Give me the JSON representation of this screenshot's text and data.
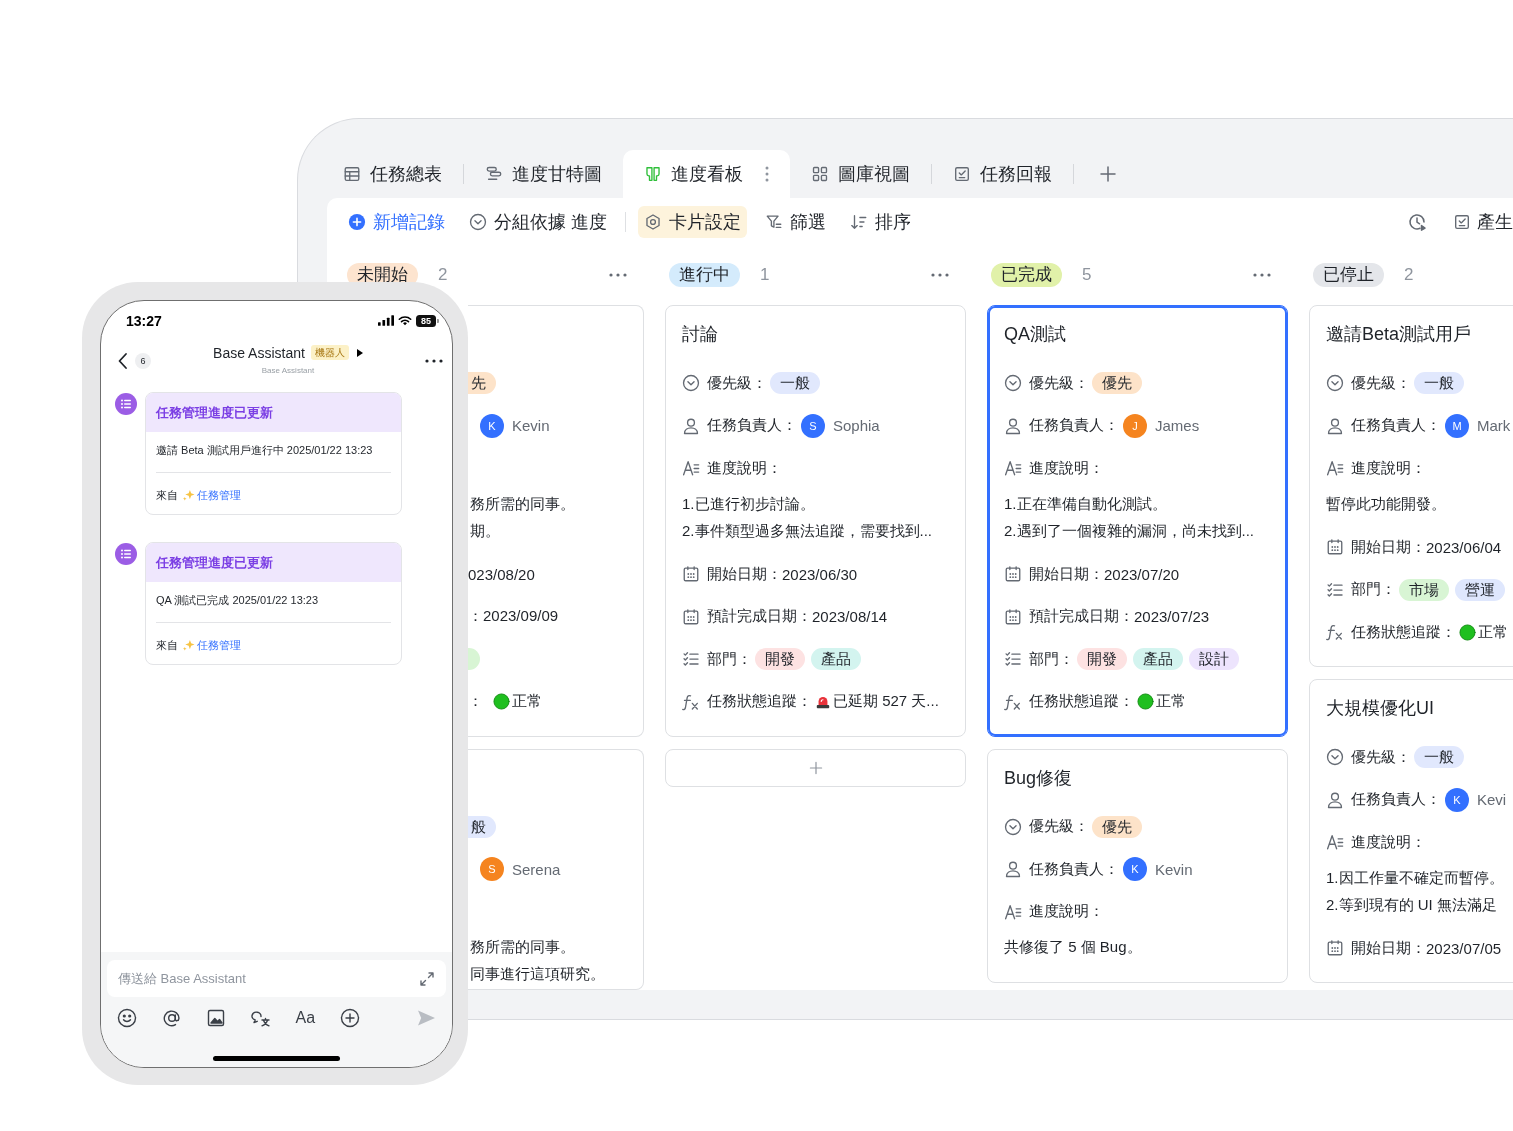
{
  "app": {
    "tabs": [
      {
        "kind": "table",
        "label": "任務總表",
        "selected": false
      },
      {
        "kind": "gantt",
        "label": "進度甘特圖",
        "selected": false
      },
      {
        "kind": "kanban",
        "label": "進度看板",
        "selected": true
      },
      {
        "kind": "gallery",
        "label": "圖庫視圖",
        "selected": false
      },
      {
        "kind": "form",
        "label": "任務回報",
        "selected": false
      }
    ],
    "toolbar": [
      {
        "kind": "add",
        "label": "新增記錄",
        "on": false
      },
      {
        "kind": "group",
        "label": "分組依據 進度",
        "on": false
      },
      {
        "kind": "card",
        "label": "卡片設定",
        "on": true
      },
      {
        "kind": "filter",
        "label": "篩選",
        "on": false
      },
      {
        "kind": "sort",
        "label": "排序",
        "on": false
      }
    ],
    "toolbar_right": [
      {
        "kind": "history"
      },
      {
        "kind": "report",
        "label": "產生"
      }
    ],
    "columns": [
      {
        "title": "未開始",
        "count": "2",
        "color": "#fde4cf",
        "more": true,
        "add_card": false,
        "cards": [
          {
            "selected": false,
            "overlapped": true,
            "fields": [
              {
                "kind": "priority",
                "value": "先",
                "color": "#fde3c9"
              },
              {
                "kind": "assignee",
                "initial": "K",
                "name": "Kevin",
                "color": "#3370ff"
              },
              {
                "kind": "description",
                "lines": [
                  "務所需的同事。",
                  "期。"
                ]
              },
              {
                "kind": "date",
                "value": "023/08/20"
              },
              {
                "kind": "date",
                "value": "：2023/09/09"
              },
              {
                "kind": "tags",
                "tags": [
                  {
                    "color": "#d8f5d4"
                  }
                ]
              },
              {
                "kind": "status",
                "label": "：",
                "overdue": false,
                "value": "正常"
              }
            ]
          },
          {
            "selected": false,
            "overlapped": true,
            "fields": [
              {
                "kind": "priority",
                "value": "般",
                "color": "#e1e8fd"
              },
              {
                "kind": "assignee",
                "initial": "S",
                "name": "Serena",
                "color": "#f5841f"
              },
              {
                "kind": "description",
                "lines": [
                  "務所需的同事。",
                  "同事進行這項研究。"
                ]
              }
            ]
          }
        ]
      },
      {
        "title": "進行中",
        "count": "1",
        "color": "#d4ebfc",
        "more": true,
        "add_card": true,
        "cards": [
          {
            "title": "討論",
            "selected": false,
            "overlapped": false,
            "fields": [
              {
                "kind": "priority",
                "label": "優先級：",
                "value": "一般",
                "color": "#e1e8fd"
              },
              {
                "kind": "assignee",
                "label": "任務負責人：",
                "initial": "S",
                "name": "Sophia",
                "color": "#3370ff"
              },
              {
                "kind": "description",
                "label": "進度說明：",
                "lines": [
                  "1.已進行初步討論。",
                  "2.事件類型過多無法追蹤，需要找到..."
                ]
              },
              {
                "kind": "date",
                "label": "開始日期：",
                "value": "2023/06/30"
              },
              {
                "kind": "date",
                "label": "預計完成日期：",
                "value": "2023/08/14"
              },
              {
                "kind": "tags",
                "label": "部門：",
                "tags": [
                  {
                    "label": "開發",
                    "color": "#fde2e2"
                  },
                  {
                    "label": "產品",
                    "color": "#d3f4ef"
                  }
                ]
              },
              {
                "kind": "status",
                "label": "任務狀態追蹤：",
                "overdue": true,
                "value": "已延期 527 天..."
              }
            ]
          }
        ]
      },
      {
        "title": "已完成",
        "count": "5",
        "color": "#e1f1a9",
        "more": true,
        "add_card": false,
        "cards": [
          {
            "title": "QA測試",
            "selected": true,
            "overlapped": false,
            "fields": [
              {
                "kind": "priority",
                "label": "優先級：",
                "value": "優先",
                "color": "#fde3c9"
              },
              {
                "kind": "assignee",
                "label": "任務負責人：",
                "initial": "J",
                "name": "James",
                "color": "#f5841f"
              },
              {
                "kind": "description",
                "label": "進度說明：",
                "lines": [
                  "1.正在準備自動化測試。",
                  "2.遇到了一個複雜的漏洞，尚未找到..."
                ]
              },
              {
                "kind": "date",
                "label": "開始日期：",
                "value": "2023/07/20"
              },
              {
                "kind": "date",
                "label": "預計完成日期：",
                "value": "2023/07/23"
              },
              {
                "kind": "tags",
                "label": "部門：",
                "tags": [
                  {
                    "label": "開發",
                    "color": "#fde2e2"
                  },
                  {
                    "label": "產品",
                    "color": "#d3f4ef"
                  },
                  {
                    "label": "設計",
                    "color": "#ede4fd"
                  }
                ]
              },
              {
                "kind": "status",
                "label": "任務狀態追蹤：",
                "overdue": false,
                "value": "正常"
              }
            ]
          },
          {
            "title": "Bug修復",
            "selected": false,
            "overlapped": false,
            "fields": [
              {
                "kind": "priority",
                "label": "優先級：",
                "value": "優先",
                "color": "#fde3c9"
              },
              {
                "kind": "assignee",
                "label": "任務負責人：",
                "initial": "K",
                "name": "Kevin",
                "color": "#3370ff"
              },
              {
                "kind": "description",
                "label": "進度說明：",
                "lines": [
                  "共修復了 5 個 Bug。"
                ]
              }
            ]
          }
        ]
      },
      {
        "title": "已停止",
        "count": "2",
        "color": "#e4e6ea",
        "more": false,
        "add_card": false,
        "cards": [
          {
            "title": "邀請Beta測試用戶",
            "selected": false,
            "overlapped": false,
            "fields": [
              {
                "kind": "priority",
                "label": "優先級：",
                "value": "一般",
                "color": "#e1e8fd"
              },
              {
                "kind": "assignee",
                "label": "任務負責人：",
                "initial": "M",
                "name": "Mark",
                "color": "#3370ff"
              },
              {
                "kind": "description",
                "label": "進度說明：",
                "lines": [
                  "暫停此功能開發。"
                ]
              },
              {
                "kind": "date",
                "label": "開始日期：",
                "value": "2023/06/04"
              },
              {
                "kind": "tags",
                "label": "部門：",
                "tags": [
                  {
                    "label": "市場",
                    "color": "#d8f5d4"
                  },
                  {
                    "label": "營運",
                    "color": "#dfe7fd"
                  }
                ]
              },
              {
                "kind": "status",
                "label": "任務狀態追蹤：",
                "overdue": false,
                "value": "正常"
              }
            ]
          },
          {
            "title": "大規模優化UI",
            "selected": false,
            "overlapped": false,
            "fields": [
              {
                "kind": "priority",
                "label": "優先級：",
                "value": "一般",
                "color": "#e1e8fd"
              },
              {
                "kind": "assignee",
                "label": "任務負責人：",
                "initial": "K",
                "name": "Kevi",
                "color": "#3370ff"
              },
              {
                "kind": "description",
                "label": "進度說明：",
                "lines": [
                  "1.因工作量不確定而暫停。",
                  "2.等到現有的 UI 無法滿足"
                ]
              },
              {
                "kind": "date",
                "label": "開始日期：",
                "value": "2023/07/05"
              }
            ]
          }
        ]
      }
    ]
  },
  "phone": {
    "status_bar": {
      "time": "13:27",
      "battery": "85"
    },
    "header": {
      "unread": "6",
      "title": "Base Assistant",
      "badge": "機器人",
      "subtitle": "Base Assistant"
    },
    "messages": [
      {
        "title": "任務管理進度已更新",
        "body": "邀請 Beta 測試用戶進行中 2025/01/22 13:23",
        "source_label": "來自",
        "source": "任務管理"
      },
      {
        "title": "任務管理進度已更新",
        "body": "QA 測試已完成 2025/01/22 13:23",
        "source_label": "來自",
        "source": "任務管理"
      }
    ],
    "composer": {
      "placeholder": "傳送給 Base Assistant",
      "format_label": "Aa"
    }
  }
}
